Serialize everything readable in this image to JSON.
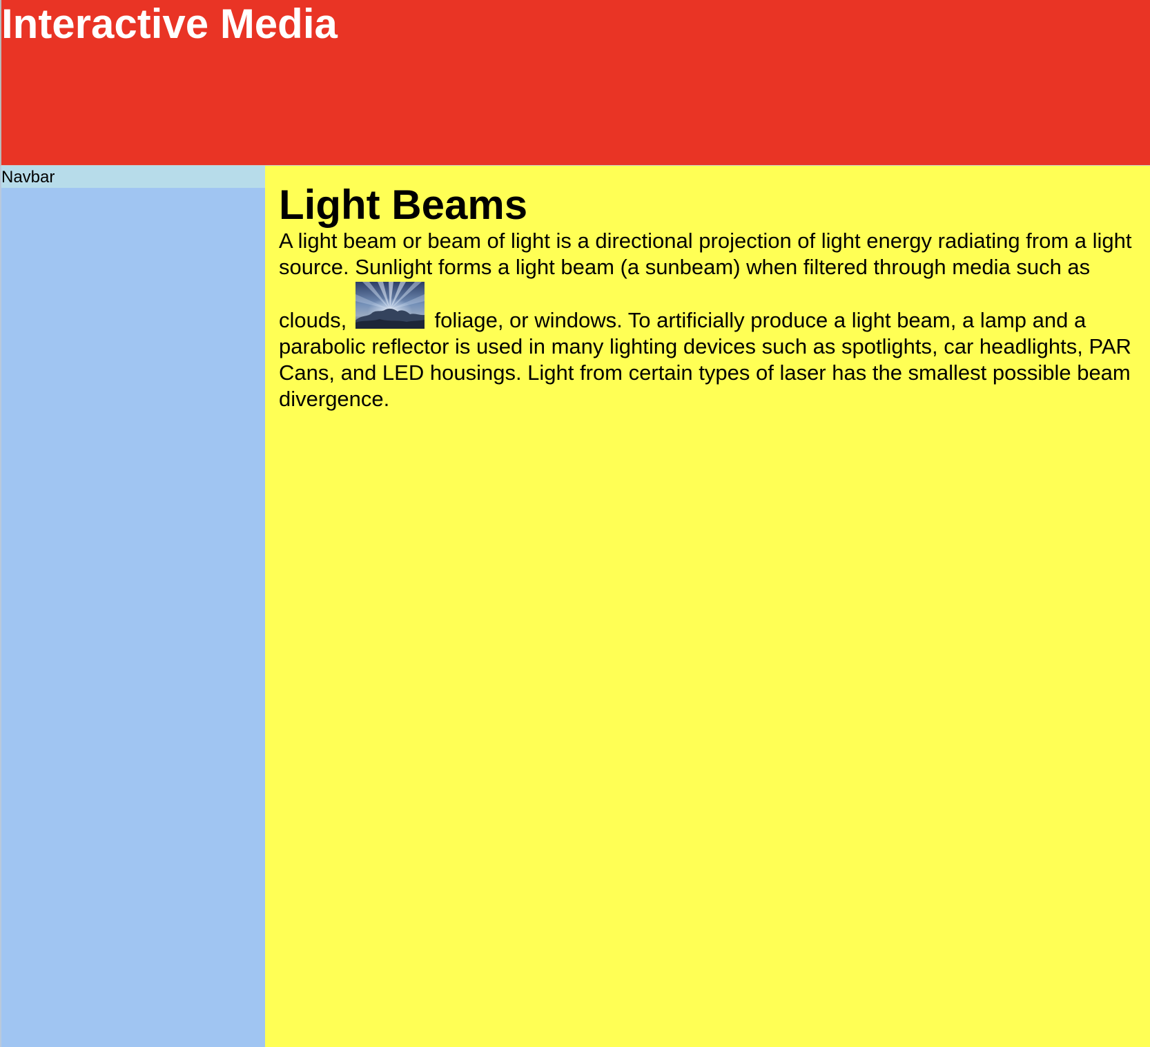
{
  "header": {
    "title": "Interactive Media"
  },
  "sidebar": {
    "label": "Navbar"
  },
  "article": {
    "title": "Light Beams",
    "text_before_image": "A light beam or beam of light is a directional projection of light energy radiating from a light source. Sunlight forms a light beam (a sunbeam) when filtered through media such as clouds,",
    "text_after_image": "foliage, or windows. To artificially produce a light beam, a lamp and a parabolic reflector is used in many lighting devices such as spotlights, car headlights, PAR Cans, and LED housings. Light from certain types of laser has the smallest possible beam divergence.",
    "image_icon": "sunbeam-clouds-image"
  },
  "colors": {
    "header_background": "#e93425",
    "header_text": "#ffffff",
    "sidebar_background": "#a0c5f2",
    "navbar_label_background": "#b7dcea",
    "main_background": "#ffff55",
    "main_text": "#000000"
  }
}
